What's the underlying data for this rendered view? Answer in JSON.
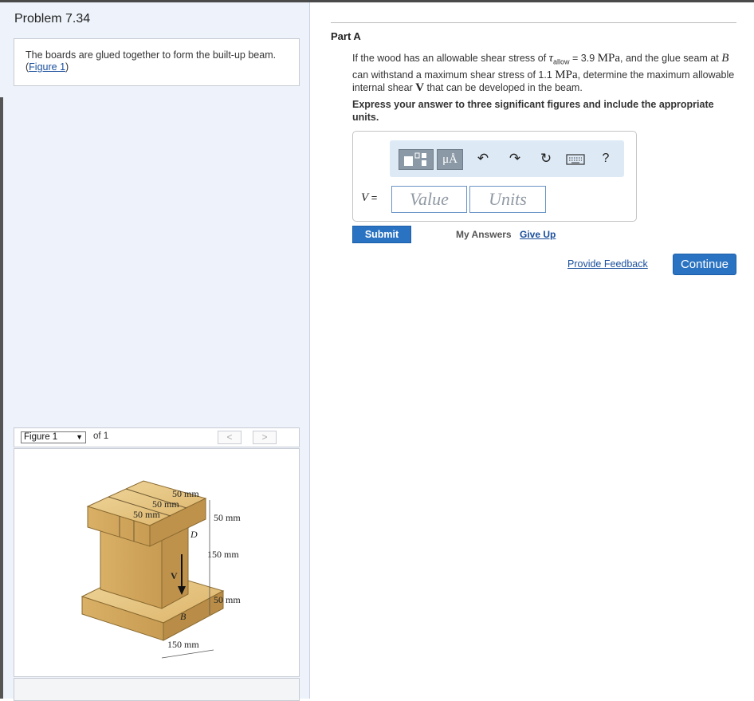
{
  "problem": {
    "title": "Problem 7.34",
    "statement": "The boards are glued together to form the built-up beam.",
    "figure_link": "Figure 1"
  },
  "figure_nav": {
    "selected": "Figure 1",
    "of_text": "of 1",
    "prev": "<",
    "next": ">"
  },
  "figure_labels": {
    "top_50_a": "50 mm",
    "top_50_b": "50 mm",
    "top_50_c": "50 mm",
    "right_50_top": "50 mm",
    "right_150": "150 mm",
    "right_50_bottom": "50 mm",
    "bottom_150": "150 mm",
    "D": "D",
    "V": "V",
    "B": "B"
  },
  "part": {
    "title": "Part A",
    "q1": "If the wood has an allowable shear stress of ",
    "tau": "τ",
    "tau_sub": "allow",
    "q2": " = 3.9 ",
    "unit1": "MPa",
    "q3": ", and the glue seam at ",
    "B": "B",
    "q4": " can withstand a maximum shear stress of 1.1 ",
    "unit2": "MPa",
    "q5": ", determine the maximum allowable internal shear ",
    "V": "V",
    "q6": " that can be developed in the beam.",
    "instructions": "Express your answer to three significant figures and include the appropriate units."
  },
  "answer": {
    "var_label": "V",
    "equals": " =",
    "value_placeholder": "Value",
    "units_placeholder": "Units"
  },
  "toolbar": {
    "units_btn": "μÅ",
    "help": "?"
  },
  "actions": {
    "submit": "Submit",
    "my_answers": "My Answers",
    "give_up": "Give Up",
    "feedback": "Provide Feedback",
    "continue": "Continue"
  },
  "colors": {
    "accent": "#2a73c2",
    "link": "#1a4f9c",
    "wood": "#e3c07e"
  }
}
